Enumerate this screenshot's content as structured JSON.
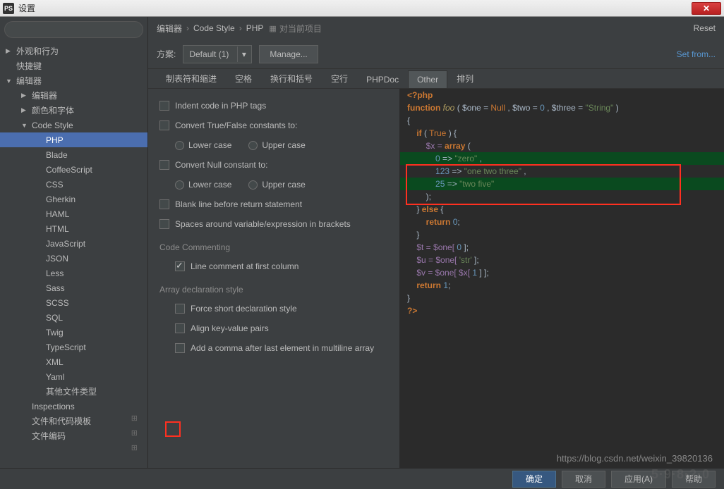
{
  "titlebar": {
    "icon": "PS",
    "title": "设置",
    "close": "✕"
  },
  "search": {
    "placeholder": ""
  },
  "tree": {
    "items": [
      {
        "label": "外观和行为",
        "level": 0,
        "arrow": "▶",
        "gear": false
      },
      {
        "label": "快捷键",
        "level": 0,
        "arrow": "",
        "gear": false
      },
      {
        "label": "编辑器",
        "level": 0,
        "arrow": "▼",
        "gear": false
      },
      {
        "label": "编辑器",
        "level": 1,
        "arrow": "▶",
        "gear": false
      },
      {
        "label": "颜色和字体",
        "level": 1,
        "arrow": "▶",
        "gear": false
      },
      {
        "label": "Code Style",
        "level": 1,
        "arrow": "▼",
        "gear": true
      },
      {
        "label": "PHP",
        "level": 2,
        "arrow": "",
        "gear": false,
        "selected": true
      },
      {
        "label": "Blade",
        "level": 2,
        "arrow": "",
        "gear": false
      },
      {
        "label": "CoffeeScript",
        "level": 2,
        "arrow": "",
        "gear": false
      },
      {
        "label": "CSS",
        "level": 2,
        "arrow": "",
        "gear": false
      },
      {
        "label": "Gherkin",
        "level": 2,
        "arrow": "",
        "gear": false
      },
      {
        "label": "HAML",
        "level": 2,
        "arrow": "",
        "gear": false
      },
      {
        "label": "HTML",
        "level": 2,
        "arrow": "",
        "gear": false
      },
      {
        "label": "JavaScript",
        "level": 2,
        "arrow": "",
        "gear": false
      },
      {
        "label": "JSON",
        "level": 2,
        "arrow": "",
        "gear": false
      },
      {
        "label": "Less",
        "level": 2,
        "arrow": "",
        "gear": false
      },
      {
        "label": "Sass",
        "level": 2,
        "arrow": "",
        "gear": false
      },
      {
        "label": "SCSS",
        "level": 2,
        "arrow": "",
        "gear": false
      },
      {
        "label": "SQL",
        "level": 2,
        "arrow": "",
        "gear": false
      },
      {
        "label": "Twig",
        "level": 2,
        "arrow": "",
        "gear": false
      },
      {
        "label": "TypeScript",
        "level": 2,
        "arrow": "",
        "gear": false
      },
      {
        "label": "XML",
        "level": 2,
        "arrow": "",
        "gear": false
      },
      {
        "label": "Yaml",
        "level": 2,
        "arrow": "",
        "gear": false
      },
      {
        "label": "其他文件类型",
        "level": 2,
        "arrow": "",
        "gear": false
      },
      {
        "label": "Inspections",
        "level": 1,
        "arrow": "",
        "gear": true
      },
      {
        "label": "文件和代码模板",
        "level": 1,
        "arrow": "",
        "gear": true
      },
      {
        "label": "文件编码",
        "level": 1,
        "arrow": "",
        "gear": true
      }
    ]
  },
  "breadcrumb": {
    "a": "编辑器",
    "b": "Code Style",
    "c": "PHP",
    "proj": "对当前项目"
  },
  "links": {
    "reset": "Reset",
    "setfrom": "Set from..."
  },
  "scheme": {
    "label": "方案:",
    "value": "Default (1)",
    "manage": "Manage..."
  },
  "tabs": [
    "制表符和缩进",
    "空格",
    "换行和括号",
    "空行",
    "PHPDoc",
    "Other",
    "排列"
  ],
  "activeTab": 5,
  "options": {
    "indent_php_tags": "Indent code in PHP tags",
    "convert_tf": "Convert True/False constants to:",
    "lower": "Lower case",
    "upper": "Upper case",
    "convert_null": "Convert Null constant to:",
    "blank_before_return": "Blank line before return statement",
    "spaces_brackets": "Spaces around variable/expression in brackets",
    "section_commenting": "Code Commenting",
    "line_comment_first": "Line comment at first column",
    "section_array": "Array declaration style",
    "force_short": "Force short declaration style",
    "align_kv": "Align key-value pairs",
    "comma_after_last": "Add a comma after last element in multiline array"
  },
  "code": {
    "l1": "<?php",
    "l2": "",
    "l3_a": "function",
    "l3_b": "foo",
    "l3_c": "( $one = ",
    "l3_d": "Null",
    "l3_e": " , $two = ",
    "l3_f": "0",
    "l3_g": " , $three = ",
    "l3_h": "\"String\"",
    "l3_i": " )",
    "l4": "{",
    "l5_a": "    if",
    "l5_b": " ( ",
    "l5_c": "True",
    "l5_d": " ) {",
    "l6_a": "        $x = ",
    "l6_b": "array",
    "l6_c": " (",
    "l7_a": "            ",
    "l7_b": "0",
    "l7_c": " => ",
    "l7_d": "\"zero\"",
    "l7_e": " ,",
    "l8_a": "            ",
    "l8_b": "123",
    "l8_c": " => ",
    "l8_d": "\"one two three\"",
    "l8_e": " ,",
    "l9_a": "            ",
    "l9_b": "25",
    "l9_c": " => ",
    "l9_d": "\"two five\"",
    "l10": "        );",
    "l11_a": "    } ",
    "l11_b": "else",
    "l11_c": " {",
    "l12_a": "        return ",
    "l12_b": "0",
    "l12_c": ";",
    "l13": "    }",
    "l14_a": "    $t = $one[ ",
    "l14_b": "0",
    "l14_c": " ];",
    "l15_a": "    $u = $one[ ",
    "l15_b": "'str'",
    "l15_c": " ];",
    "l16_a": "    $v = $one[ $x[ ",
    "l16_b": "1",
    "l16_c": " ] ];",
    "l17_a": "    return ",
    "l17_b": "1",
    "l17_c": ";",
    "l18": "}",
    "l19": "",
    "l20": "?>"
  },
  "footer": {
    "ok": "确定",
    "cancel": "取消",
    "apply": "应用(A)",
    "help": "帮助"
  },
  "watermark": "https://blog.csdn.net/weixin_39820136",
  "watermark2": "5·9·8·2·0"
}
